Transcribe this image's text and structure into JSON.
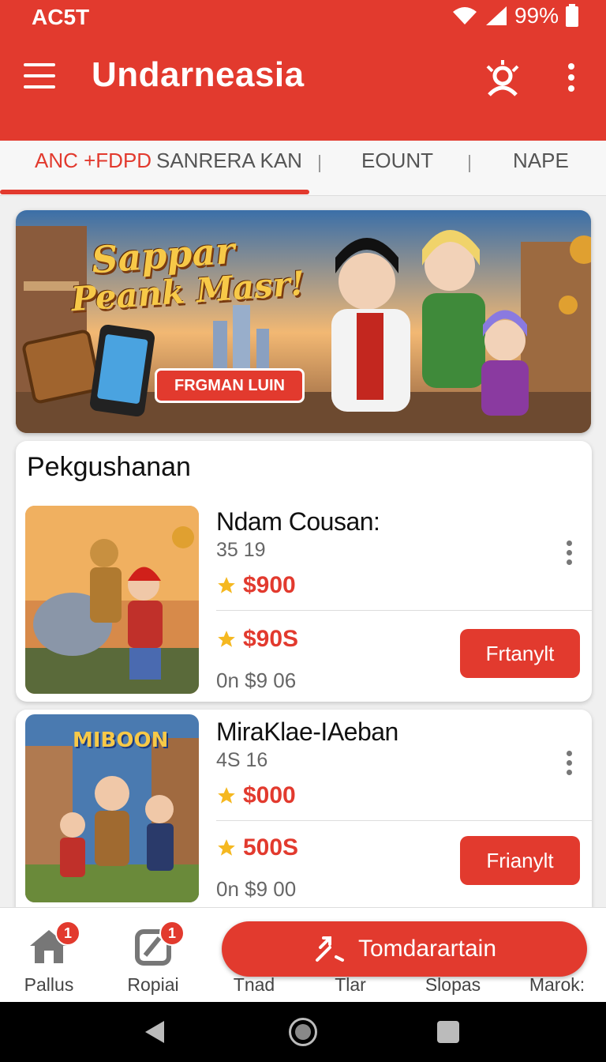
{
  "status": {
    "carrier": "AC5T",
    "battery": "99%"
  },
  "app": {
    "title": "Undarneasia"
  },
  "tabs": [
    {
      "label": "ANC +FDPD",
      "active": true
    },
    {
      "label": "SANRERA KAN",
      "active": false
    },
    {
      "label": "EOUNT",
      "active": false
    },
    {
      "label": "NAPE",
      "active": false
    }
  ],
  "banner": {
    "title_line1": "Sappar",
    "title_line2": "Peank Masr!",
    "button": "FRGMAN LUIN"
  },
  "section": {
    "title": "Pekgushanan"
  },
  "items": [
    {
      "name": "Ndam Cousan:",
      "sub": "35 19",
      "price1": "$900",
      "price2": "$90S",
      "meta": "0n $9 06",
      "button": "Frtanylt"
    },
    {
      "name": "MiraKlae-IAeban",
      "sub": "4S 16",
      "banner_text": "MIBOON",
      "price1": "$000",
      "price2": "500S",
      "meta": "0n $9 00",
      "button": "Frianylt"
    }
  ],
  "bottom_nav": [
    {
      "label": "Pallus",
      "badge": "1",
      "icon": "home-icon"
    },
    {
      "label": "Ropiai",
      "badge": "1",
      "icon": "edit-icon"
    },
    {
      "label": "Tnad"
    },
    {
      "label": "Tlar"
    },
    {
      "label": "Slopas"
    },
    {
      "label": "Marok:"
    }
  ],
  "fab": {
    "label": "Tomdarartain"
  },
  "colors": {
    "accent": "#e23a2e",
    "star": "#f5b820"
  }
}
